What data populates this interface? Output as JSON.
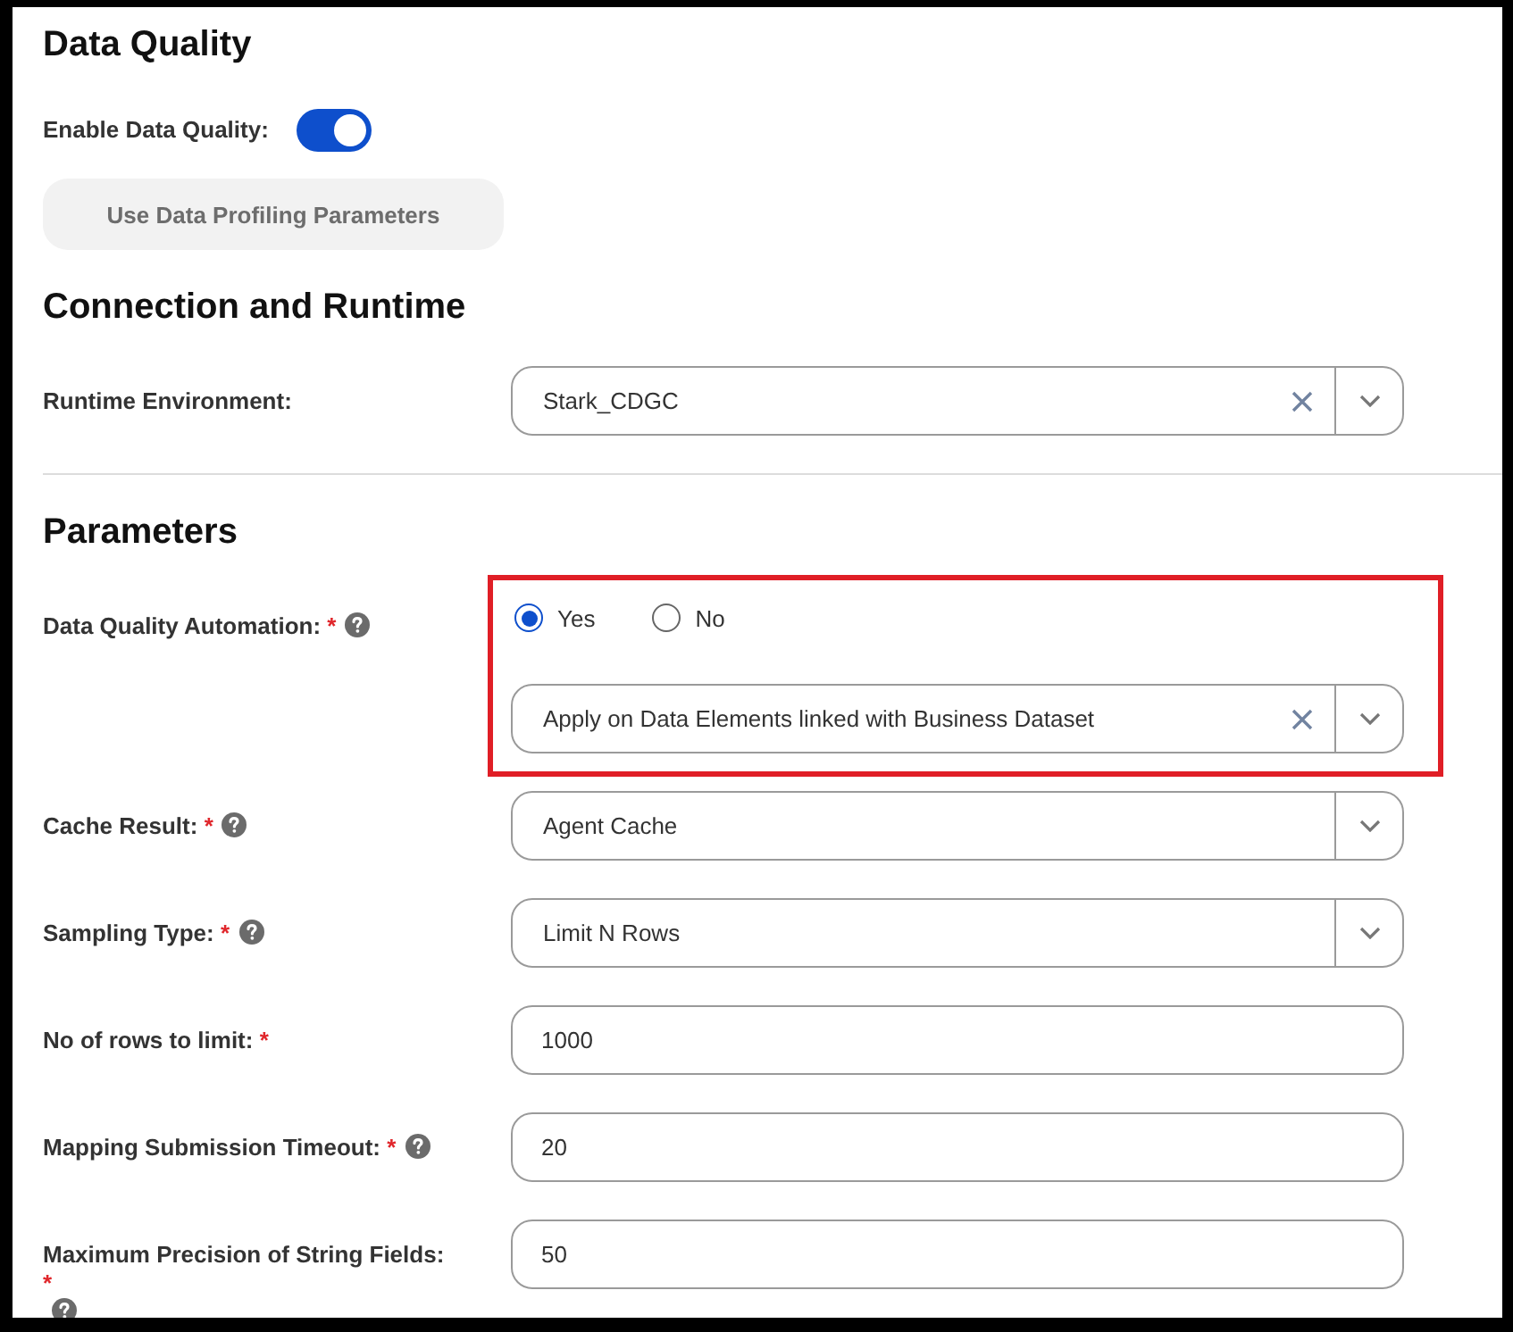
{
  "data_quality": {
    "title": "Data Quality",
    "toggle": {
      "label": "Enable Data Quality:",
      "on": true
    },
    "button": {
      "label": "Use Data Profiling Parameters",
      "disabled": true
    }
  },
  "connection": {
    "title": "Connection and Runtime",
    "fields": [
      {
        "kind": "select",
        "label": "Runtime Environment:",
        "help": false,
        "highlighted": false,
        "value": "Stark_CDGC",
        "clearable": true
      }
    ]
  },
  "parameters": {
    "title": "Parameters",
    "fields": [
      {
        "kind": "radio_select",
        "label": "Data Quality Automation:",
        "required_mark": "*",
        "help": true,
        "highlighted": true,
        "options": [
          {
            "label": "Yes",
            "selected": true
          },
          {
            "label": "No",
            "selected": false
          }
        ],
        "value": "Apply on Data Elements linked with Business Dataset",
        "clearable": true
      },
      {
        "kind": "select",
        "label": "Cache Result:",
        "required_mark": "*",
        "help": true,
        "highlighted": false,
        "value": "Agent Cache",
        "clearable": false
      },
      {
        "kind": "select",
        "label": "Sampling Type:",
        "required_mark": "*",
        "help": true,
        "highlighted": false,
        "value": "Limit N Rows",
        "clearable": false
      },
      {
        "kind": "input",
        "label": "No of rows to limit:",
        "required_mark": "*",
        "help": false,
        "highlighted": false,
        "value": "1000"
      },
      {
        "kind": "input",
        "label": "Mapping Submission Timeout:",
        "required_mark": "*",
        "help": true,
        "highlighted": false,
        "value": "20"
      },
      {
        "kind": "input",
        "label": "Maximum Precision of String Fields:",
        "required_mark": "*",
        "help": true,
        "highlighted": false,
        "value": "50"
      }
    ]
  }
}
